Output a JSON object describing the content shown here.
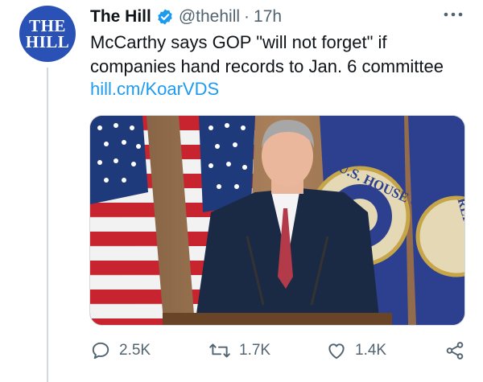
{
  "account": {
    "avatar_text_line1": "THE",
    "avatar_text_line2": "HILL",
    "display_name": "The Hill",
    "handle": "@thehill",
    "separator": "·",
    "time": "17h",
    "verified": true
  },
  "tweet": {
    "text": "McCarthy says GOP \"will not forget\" if companies hand records to Jan. 6 committee",
    "link": "hill.cm/KoarVDS"
  },
  "media": {
    "description_icon": "photo",
    "seal_text": "U.S. HOUSE OF REPRESEN",
    "seal_text_right": "REPRESEN"
  },
  "actions": {
    "reply_count": "2.5K",
    "retweet_count": "1.7K",
    "like_count": "1.4K"
  },
  "colors": {
    "avatar_bg": "#2a51b5",
    "link": "#1d9bf0",
    "verified": "#1d9bf0",
    "muted": "#536471"
  }
}
